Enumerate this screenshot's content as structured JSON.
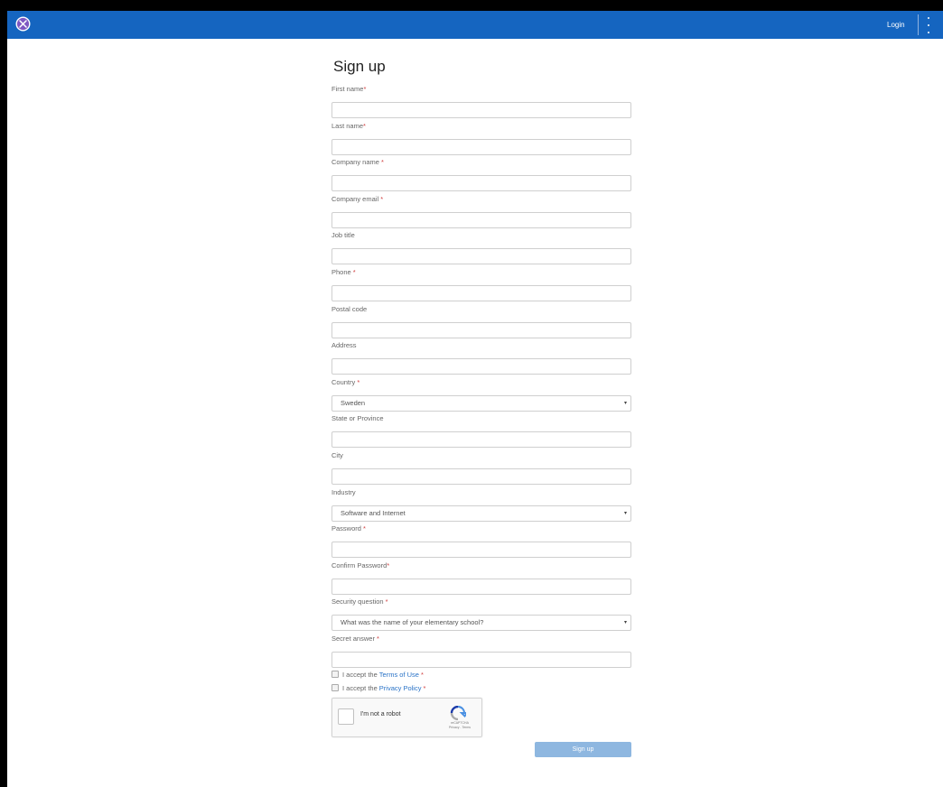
{
  "topbar": {
    "login_label": "Login",
    "accent": "#1565c0"
  },
  "form": {
    "title": "Sign up",
    "fields": [
      {
        "label": "First name",
        "required": "*",
        "value": ""
      },
      {
        "label": "Last name",
        "required": "*",
        "value": ""
      },
      {
        "label": "Company name",
        "required": " *",
        "value": ""
      },
      {
        "label": "Company email",
        "required": " *",
        "value": ""
      },
      {
        "label": "Job title",
        "required": "",
        "value": ""
      },
      {
        "label": "Phone",
        "required": " *",
        "value": ""
      },
      {
        "label": "Postal code",
        "required": "",
        "value": ""
      },
      {
        "label": "Address",
        "required": "",
        "value": ""
      },
      {
        "label": "Country",
        "required": " *",
        "value": "Sweden"
      },
      {
        "label": "State or Province",
        "required": "",
        "value": ""
      },
      {
        "label": "City",
        "required": "",
        "value": ""
      },
      {
        "label": "Industry",
        "required": "",
        "value": "Software and Internet"
      },
      {
        "label": "Password",
        "required": " *",
        "value": ""
      },
      {
        "label": "Confirm Password",
        "required": "*",
        "value": ""
      },
      {
        "label": "Security question",
        "required": " *",
        "value": "What was the name of your elementary school?"
      },
      {
        "label": "Secret answer",
        "required": " *",
        "value": ""
      }
    ],
    "terms": {
      "prefix": "I accept the",
      "link": "Terms of Use",
      "required": "*"
    },
    "privacy": {
      "prefix": "I accept the",
      "link": "Privacy Policy",
      "required": "*"
    },
    "captcha": {
      "label": "I'm not a robot",
      "brand": "reCAPTCHA",
      "links": "Privacy - Terms"
    },
    "submit_label": "Sign up"
  }
}
